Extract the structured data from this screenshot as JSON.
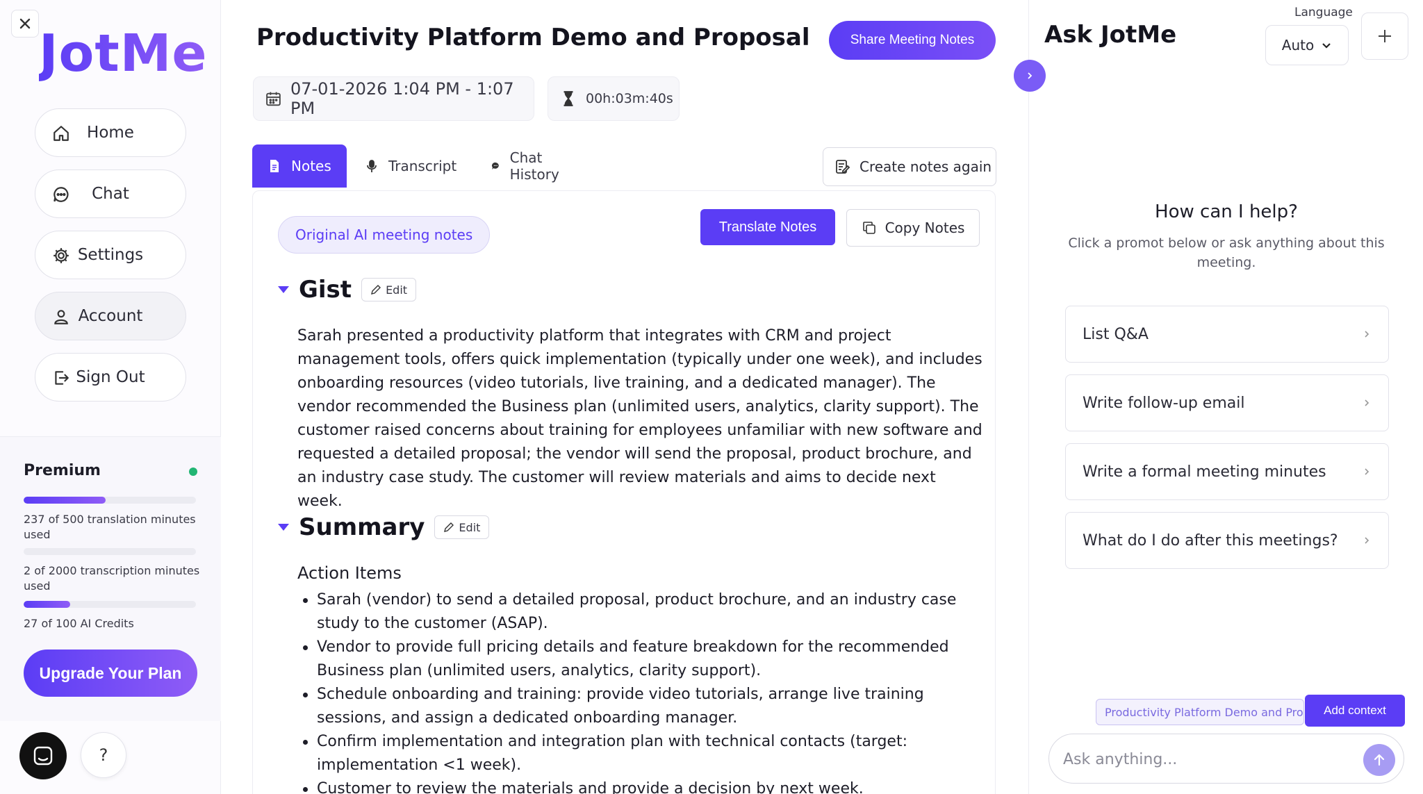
{
  "sidebar": {
    "logo": "JotMe",
    "nav": [
      {
        "label": "Home",
        "icon": "home-icon"
      },
      {
        "label": "Chat",
        "icon": "chat-icon"
      },
      {
        "label": "Settings",
        "icon": "gear-icon"
      },
      {
        "label": "Account",
        "icon": "user-icon"
      },
      {
        "label": "Sign Out",
        "icon": "sign-out-icon"
      }
    ],
    "plan": {
      "title": "Premium",
      "usage": [
        {
          "text": "237 of 500 translation minutes used",
          "fraction": 0.474
        },
        {
          "text": "2 of 2000 transcription minutes used",
          "fraction": 0.001
        },
        {
          "text": "27 of 100 AI Credits",
          "fraction": 0.27
        }
      ],
      "upgrade_label": "Upgrade Your Plan"
    },
    "help_label": "?"
  },
  "main": {
    "title": "Productivity Platform Demo and Proposal",
    "share_label": "Share Meeting Notes",
    "datetime": "07-01-2026 1:04 PM - 1:07 PM",
    "duration": "00h:03m:40s",
    "tabs": [
      {
        "label": "Notes",
        "active": true
      },
      {
        "label": "Transcript",
        "active": false
      },
      {
        "label": "Chat History",
        "active": false
      }
    ],
    "recreate_label": "Create notes again",
    "notes": {
      "pill_label": "Original AI meeting notes",
      "translate_label": "Translate Notes",
      "copy_label": "Copy Notes",
      "edit_label": "Edit",
      "gist_title": "Gist",
      "gist_text": "Sarah presented a productivity platform that integrates with CRM and project management tools, offers quick implementation (typically under one week), and includes onboarding resources (video tutorials, live training, and a dedicated manager). The vendor recommended the Business plan (unlimited users, analytics, clarity support). The customer raised concerns about training for employees unfamiliar with new software and requested a detailed proposal; the vendor will send the proposal, product brochure, and an industry case study. The customer will review materials and aims to decide next week.",
      "summary_title": "Summary",
      "action_items_title": "Action Items",
      "action_items": [
        "Sarah (vendor) to send a detailed proposal, product brochure, and an industry case study to the customer (ASAP).",
        "Vendor to provide full pricing details and feature breakdown for the recommended Business plan (unlimited users, analytics, clarity support).",
        "Schedule onboarding and training: provide video tutorials, arrange live training sessions, and assign a dedicated onboarding manager.",
        "Confirm implementation and integration plan with technical contacts (target: implementation <1 week).",
        "Customer to review the materials and provide a decision by next week."
      ]
    }
  },
  "ask": {
    "title": "Ask JotMe",
    "language_label": "Language",
    "language_value": "Auto",
    "help_title": "How can I help?",
    "help_sub": "Click a promot below or ask anything about this meeting.",
    "prompts": [
      "List Q&A",
      "Write follow-up email",
      "Write a formal meeting minutes",
      "What do I do after this meetings?"
    ],
    "context_chip": "Productivity Platform Demo and Proposal",
    "add_context_label": "Add context",
    "input_placeholder": "Ask anything..."
  },
  "colors": {
    "accent": "#5b3df5",
    "accent_light": "#8f5cf6",
    "status_green": "#22b573"
  }
}
